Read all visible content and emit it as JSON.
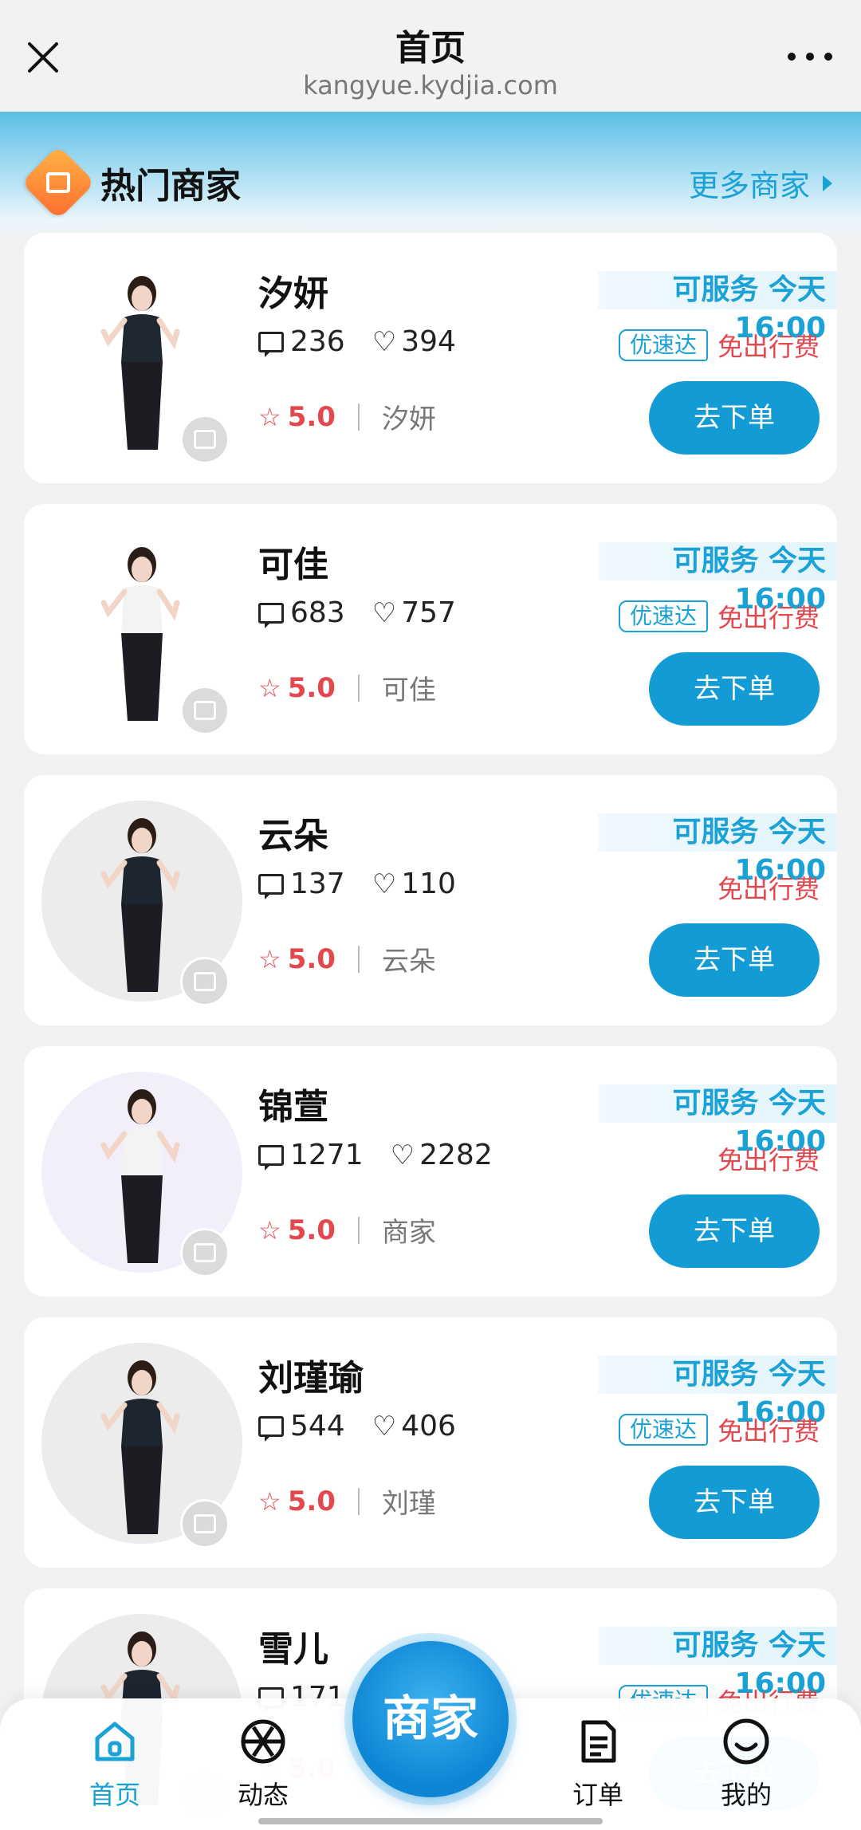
{
  "topbar": {
    "title": "首页",
    "url": "kangyue.kydjia.com"
  },
  "section": {
    "title": "热门商家",
    "more_label": "更多商家"
  },
  "merchants": [
    {
      "name": "汐妍",
      "comments": "236",
      "likes": "394",
      "rating": "5.0",
      "alias": "汐妍",
      "availability": "可服务  今天16:00",
      "fast_tag": "优速达",
      "free_tag": "免出行费",
      "order_label": "去下单",
      "has_fast": true,
      "avatar_bg": "plain",
      "outfit": "#1c1c22",
      "top": "#1f2730"
    },
    {
      "name": "可佳",
      "comments": "683",
      "likes": "757",
      "rating": "5.0",
      "alias": "可佳",
      "availability": "可服务  今天16:00",
      "fast_tag": "优速达",
      "free_tag": "免出行费",
      "order_label": "去下单",
      "has_fast": true,
      "avatar_bg": "plain",
      "outfit": "#1c1c22",
      "top": "#f3f3f3"
    },
    {
      "name": "云朵",
      "comments": "137",
      "likes": "110",
      "rating": "5.0",
      "alias": "云朵",
      "availability": "可服务  今天16:00",
      "fast_tag": "",
      "free_tag": "免出行费",
      "order_label": "去下单",
      "has_fast": false,
      "avatar_bg": "grey",
      "outfit": "#1c1c22",
      "top": "#1c2530"
    },
    {
      "name": "锦萱",
      "comments": "1271",
      "likes": "2282",
      "rating": "5.0",
      "alias": "商家",
      "availability": "可服务  今天16:00",
      "fast_tag": "",
      "free_tag": "免出行费",
      "order_label": "去下单",
      "has_fast": false,
      "avatar_bg": "lav",
      "outfit": "#1c1c22",
      "top": "#f3f3f3"
    },
    {
      "name": "刘瑾瑜",
      "comments": "544",
      "likes": "406",
      "rating": "5.0",
      "alias": "刘瑾",
      "availability": "可服务  今天16:00",
      "fast_tag": "优速达",
      "free_tag": "免出行费",
      "order_label": "去下单",
      "has_fast": true,
      "avatar_bg": "grey",
      "outfit": "#1c1c22",
      "top": "#1c2530"
    },
    {
      "name": "雪儿",
      "comments": "171",
      "likes": "",
      "rating": "5.0",
      "alias": "",
      "availability": "可服务  今天16:00",
      "fast_tag": "优速达",
      "free_tag": "免出行费",
      "order_label": "去下单",
      "has_fast": true,
      "avatar_bg": "grey",
      "outfit": "#1c1c22",
      "top": "#1c2530"
    }
  ],
  "bottom_nav": {
    "home": "首页",
    "feed": "动态",
    "center": "商家",
    "orders": "订单",
    "me": "我的"
  },
  "colors": {
    "accent": "#1aa2d6",
    "button": "#129bd4",
    "rating": "#e4484f"
  }
}
